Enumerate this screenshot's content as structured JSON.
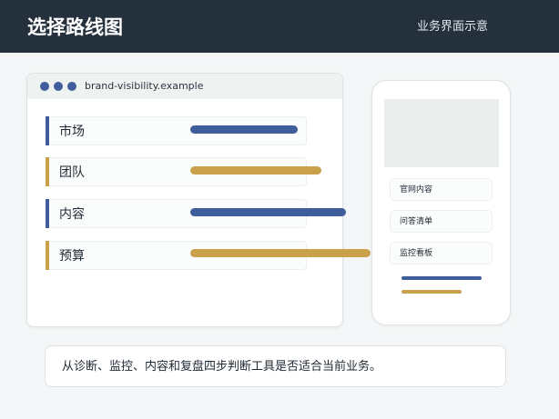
{
  "header": {
    "title": "选择路线图",
    "subtitle": "业务界面示意"
  },
  "colors": {
    "header_bg": "#25303d",
    "blue": "#3f5d9b",
    "gold": "#c9a14a"
  },
  "browser": {
    "url": "brand-visibility.example",
    "rows": [
      {
        "label": "市场",
        "accent": "blue"
      },
      {
        "label": "团队",
        "accent": "gold"
      },
      {
        "label": "内容",
        "accent": "blue"
      },
      {
        "label": "预算",
        "accent": "gold"
      }
    ]
  },
  "phone": {
    "items": [
      {
        "label": "官网内容"
      },
      {
        "label": "问答清单"
      },
      {
        "label": "监控看板"
      }
    ]
  },
  "caption": {
    "text": "从诊断、监控、内容和复盘四步判断工具是否适合当前业务。"
  }
}
